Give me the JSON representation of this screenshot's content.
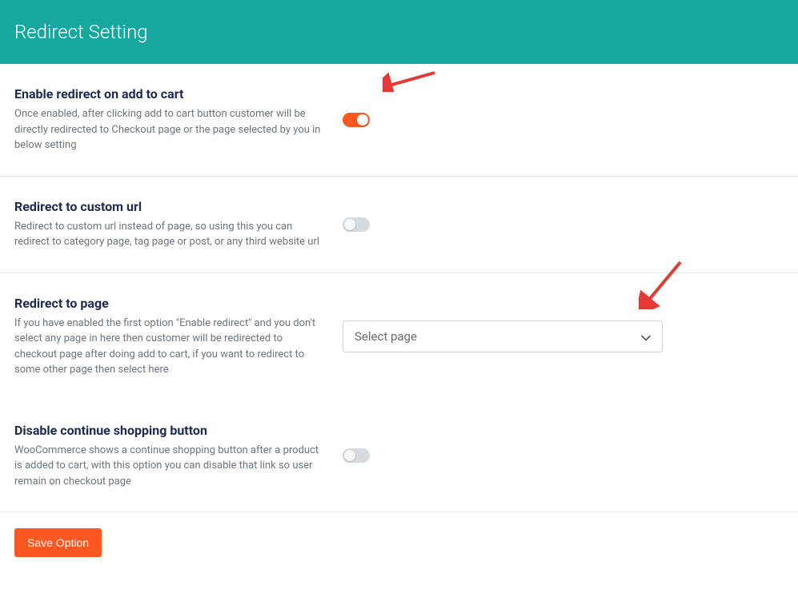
{
  "header": {
    "title": "Redirect Setting"
  },
  "settings": {
    "enable_redirect": {
      "title": "Enable redirect on add to cart",
      "desc": "Once enabled, after clicking add to cart button customer will be directly redirected to Checkout page or the page selected by you in below setting",
      "toggle": true
    },
    "custom_url": {
      "title": "Redirect to custom url",
      "desc": "Redirect to custom url instead of page, so using this you can redirect to category page, tag page or post, or any third website url",
      "toggle": false
    },
    "redirect_page": {
      "title": "Redirect to page",
      "desc": "If you have enabled the first option \"Enable redirect\" and you don't select any page in here then customer will be redirected to checkout page after doing add to cart, if you want to redirect to some other page then select here",
      "select_placeholder": "Select page"
    },
    "disable_continue": {
      "title": "Disable continue shopping button",
      "desc": "WooCommerce shows a continue shopping button after a product is added to cart, with this option you can disable that link so user remain on checkout page",
      "toggle": false
    }
  },
  "actions": {
    "save_label": "Save Option"
  }
}
